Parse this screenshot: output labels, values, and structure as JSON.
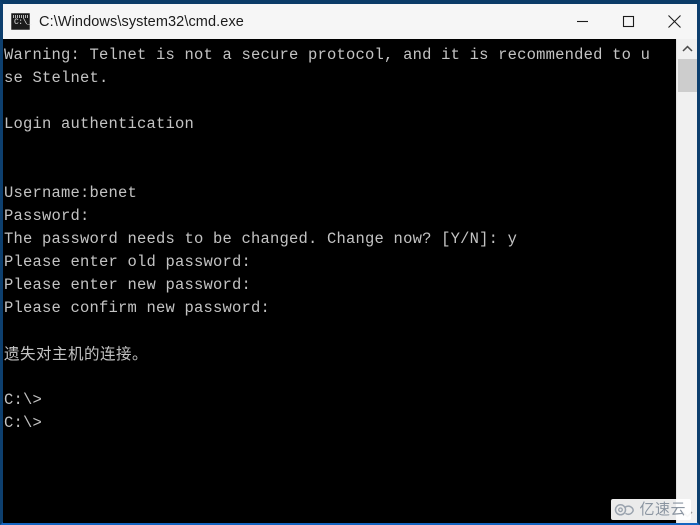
{
  "window": {
    "title": "C:\\Windows\\system32\\cmd.exe",
    "icon_name": "cmd-icon",
    "icon_text": "C:\\_",
    "border_color": "#0d3f6e",
    "titlebar_bg": "#f6f6f6",
    "titlebar_fg": "#1c1c1c"
  },
  "controls": {
    "minimize_label": "Minimize",
    "maximize_label": "Maximize",
    "close_label": "Close"
  },
  "console": {
    "background": "#000000",
    "foreground": "#c3c3c3",
    "lines": [
      {
        "text": "Warning: Telnet is not a secure protocol, and it is recommended to u",
        "cjk": false
      },
      {
        "text": "se Stelnet.",
        "cjk": false
      },
      {
        "text": "",
        "cjk": false
      },
      {
        "text": "Login authentication",
        "cjk": false
      },
      {
        "text": "",
        "cjk": false
      },
      {
        "text": "",
        "cjk": false
      },
      {
        "text": "Username:benet",
        "cjk": false
      },
      {
        "text": "Password:",
        "cjk": false
      },
      {
        "text": "The password needs to be changed. Change now? [Y/N]: y",
        "cjk": false
      },
      {
        "text": "Please enter old password:",
        "cjk": false
      },
      {
        "text": "Please enter new password:",
        "cjk": false
      },
      {
        "text": "Please confirm new password:",
        "cjk": false
      },
      {
        "text": "",
        "cjk": false
      },
      {
        "text": "遗失对主机的连接。",
        "cjk": true
      },
      {
        "text": "",
        "cjk": false
      },
      {
        "text": "C:\\>",
        "cjk": false
      },
      {
        "text": "C:\\>",
        "cjk": false
      }
    ]
  },
  "scrollbar": {
    "up_arrow_label": "Scroll up",
    "down_arrow_label": "Scroll down",
    "thumb_label": "Scroll thumb"
  },
  "watermark": {
    "text": "亿速云",
    "color": "#8b95a1"
  }
}
